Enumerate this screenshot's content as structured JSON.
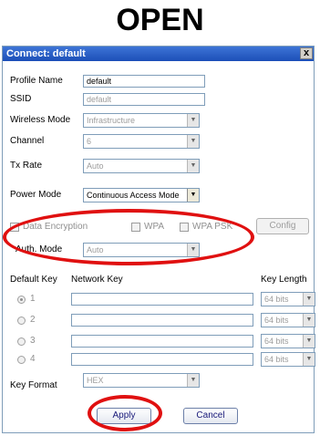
{
  "page": {
    "heading": "OPEN"
  },
  "window": {
    "title": "Connect: default",
    "close_glyph": "x"
  },
  "form": {
    "profile_name": {
      "label": "Profile Name",
      "value": "default"
    },
    "ssid": {
      "label": "SSID",
      "value": "default"
    },
    "wireless_mode": {
      "label": "Wireless Mode",
      "value": "Infrastructure"
    },
    "channel": {
      "label": "Channel",
      "value": "6"
    },
    "tx_rate": {
      "label": "Tx Rate",
      "value": "Auto"
    },
    "power_mode": {
      "label": "Power Mode",
      "value": "Continuous Access Mode"
    },
    "data_encryption": {
      "label": "Data Encryption",
      "checked": false
    },
    "wpa": {
      "label": "WPA",
      "checked": false
    },
    "wpa_psk": {
      "label": "WPA PSK",
      "checked": false
    },
    "config_button": "Config",
    "auth_mode": {
      "label": "Auth. Mode",
      "value": "Auto"
    },
    "keys": {
      "default_key_header": "Default Key",
      "network_key_header": "Network Key",
      "key_length_header": "Key Length",
      "rows": [
        {
          "label": "1",
          "key": "",
          "length": "64 bits",
          "selected": true
        },
        {
          "label": "2",
          "key": "",
          "length": "64 bits",
          "selected": false
        },
        {
          "label": "3",
          "key": "",
          "length": "64 bits",
          "selected": false
        },
        {
          "label": "4",
          "key": "",
          "length": "64 bits",
          "selected": false
        }
      ]
    },
    "key_format": {
      "label": "Key Format",
      "value": "HEX"
    }
  },
  "buttons": {
    "apply": "Apply",
    "cancel": "Cancel"
  },
  "colors": {
    "titlebar": "#1c4fb8",
    "highlight_oval": "#e01010",
    "disabled_text": "#9c9c9c"
  },
  "icons": {
    "close": "close-icon",
    "dropdown": "chevron-down-icon"
  }
}
